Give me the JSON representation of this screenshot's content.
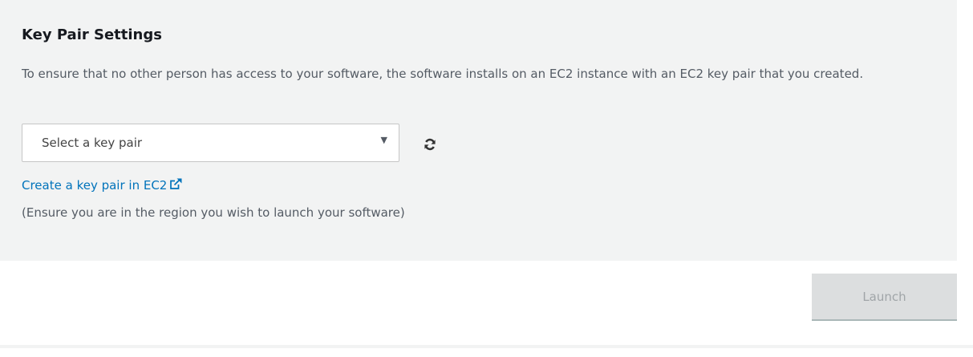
{
  "key_pair": {
    "title": "Key Pair Settings",
    "description": "To ensure that no other person has access to your software, the software installs on an EC2 instance with an EC2 key pair that you created.",
    "select": {
      "value": "Select a key pair"
    },
    "refresh_icon": "refresh-icon",
    "create_link_label": "Create a key pair in EC2",
    "external_link_icon": "external-link-icon",
    "region_note": "(Ensure you are in the region you wish to launch your software)"
  },
  "actions": {
    "launch_label": "Launch",
    "launch_disabled": true
  },
  "colors": {
    "panel_bg": "#f2f3f3",
    "link": "#0073bb",
    "disabled_button_bg": "#dcdedf",
    "disabled_button_text": "#a0a5a8"
  }
}
